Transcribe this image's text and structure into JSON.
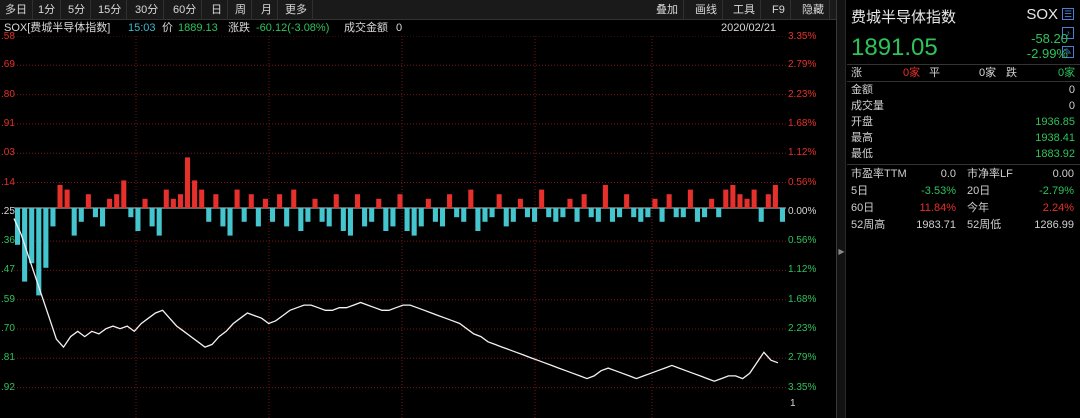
{
  "toolbar": {
    "left_items": [
      "多日",
      "1分",
      "5分",
      "15分",
      "30分",
      "60分",
      "日",
      "周",
      "月",
      "更多"
    ],
    "right_items": [
      "叠加",
      "画线",
      "工具",
      "F9",
      "隐藏"
    ]
  },
  "infobar": {
    "index_name": "SOX[费城半导体指数]",
    "time": "15:03",
    "price_label": "价",
    "price": "1889.13",
    "change_label": "涨跌",
    "change": "-60.12(-3.08%)",
    "turnover_label": "成交金额",
    "turnover": "0",
    "date": "2020/02/21"
  },
  "axis": {
    "left_labels": [
      {
        "text": ".58",
        "color": "#e6302b"
      },
      {
        "text": ".69",
        "color": "#e6302b"
      },
      {
        "text": ".80",
        "color": "#e6302b"
      },
      {
        "text": ".91",
        "color": "#e6302b"
      },
      {
        "text": ".03",
        "color": "#e6302b"
      },
      {
        "text": ".14",
        "color": "#e6302b"
      },
      {
        "text": ".25",
        "color": "#d8d8d8"
      },
      {
        "text": ".36",
        "color": "#2ec25b"
      },
      {
        "text": ".47",
        "color": "#2ec25b"
      },
      {
        "text": ".59",
        "color": "#2ec25b"
      },
      {
        "text": ".70",
        "color": "#2ec25b"
      },
      {
        "text": ".81",
        "color": "#2ec25b"
      },
      {
        "text": ".92",
        "color": "#2ec25b"
      }
    ],
    "right_labels": [
      {
        "text": "3.35%",
        "color": "#e6302b"
      },
      {
        "text": "2.79%",
        "color": "#e6302b"
      },
      {
        "text": "2.23%",
        "color": "#e6302b"
      },
      {
        "text": "1.68%",
        "color": "#e6302b"
      },
      {
        "text": "1.12%",
        "color": "#e6302b"
      },
      {
        "text": "0.56%",
        "color": "#e6302b"
      },
      {
        "text": "0.00%",
        "color": "#d8d8d8"
      },
      {
        "text": "0.56%",
        "color": "#2ec25b"
      },
      {
        "text": "1.12%",
        "color": "#2ec25b"
      },
      {
        "text": "1.68%",
        "color": "#2ec25b"
      },
      {
        "text": "2.23%",
        "color": "#2ec25b"
      },
      {
        "text": "2.79%",
        "color": "#2ec25b"
      },
      {
        "text": "3.35%",
        "color": "#2ec25b"
      }
    ],
    "bottom_right": "1"
  },
  "colors": {
    "up": "#e6302b",
    "down": "#2ec25b",
    "bar_down": "#45c6cf",
    "price_line": "#f2f2f2",
    "grid": "#7a1414",
    "zero_line": "#c8c8c8"
  },
  "chart_data": {
    "type": "line",
    "description_series": [
      {
        "name": "",
        "kind": "intraday_price_pct",
        "values": [
          -0.2,
          -0.5,
          -0.9,
          -1.3,
          -1.7,
          -2.1,
          -2.5,
          -2.65,
          -2.45,
          -2.35,
          -2.45,
          -2.35,
          -2.4,
          -2.3,
          -2.25,
          -2.3,
          -2.25,
          -2.35,
          -2.2,
          -2.1,
          -2.0,
          -1.95,
          -2.1,
          -2.25,
          -2.35,
          -2.45,
          -2.55,
          -2.65,
          -2.6,
          -2.45,
          -2.35,
          -2.2,
          -2.1,
          -2.0,
          -2.05,
          -2.1,
          -2.2,
          -2.15,
          -2.05,
          -1.95,
          -1.9,
          -1.85,
          -1.85,
          -1.9,
          -1.95,
          -1.95,
          -1.9,
          -1.9,
          -1.85,
          -1.8,
          -1.85,
          -1.9,
          -1.95,
          -1.95,
          -1.9,
          -1.85,
          -1.85,
          -1.9,
          -1.95,
          -2.0,
          -2.05,
          -2.1,
          -2.15,
          -2.2,
          -2.3,
          -2.4,
          -2.45,
          -2.55,
          -2.6,
          -2.65,
          -2.7,
          -2.75,
          -2.8,
          -2.85,
          -2.9,
          -2.95,
          -3.0,
          -3.05,
          -3.1,
          -3.15,
          -3.2,
          -3.25,
          -3.2,
          -3.1,
          -3.05,
          -3.1,
          -3.15,
          -3.2,
          -3.25,
          -3.2,
          -3.15,
          -3.1,
          -3.05,
          -3.0,
          -3.05,
          -3.1,
          -3.15,
          -3.2,
          -3.25,
          -3.3,
          -3.25,
          -3.2,
          -3.2,
          -3.25,
          -3.15,
          -2.95,
          -2.75,
          -2.9,
          -2.95
        ]
      },
      {
        "name": "",
        "kind": "momentum_bars",
        "values": [
          -0.8,
          -1.6,
          -1.2,
          -1.9,
          -1.3,
          -0.4,
          0.5,
          0.4,
          -0.6,
          -0.3,
          0.3,
          -0.2,
          -0.4,
          0.2,
          0.3,
          0.6,
          -0.2,
          -0.5,
          0.2,
          -0.4,
          -0.6,
          0.4,
          0.2,
          0.3,
          1.1,
          0.6,
          0.4,
          -0.3,
          0.3,
          -0.4,
          -0.6,
          0.4,
          -0.3,
          0.3,
          -0.4,
          0.2,
          -0.3,
          0.3,
          -0.4,
          0.4,
          -0.5,
          -0.3,
          0.2,
          -0.3,
          -0.4,
          0.3,
          -0.5,
          -0.6,
          0.3,
          -0.4,
          -0.3,
          0.2,
          -0.5,
          -0.4,
          0.3,
          -0.5,
          -0.6,
          -0.4,
          0.2,
          -0.3,
          -0.4,
          0.3,
          -0.2,
          -0.3,
          0.4,
          -0.5,
          -0.3,
          -0.2,
          0.3,
          -0.4,
          -0.3,
          0.2,
          -0.2,
          -0.3,
          0.4,
          -0.2,
          -0.3,
          -0.2,
          0.2,
          -0.3,
          0.3,
          -0.2,
          -0.3,
          0.5,
          -0.3,
          -0.2,
          0.3,
          -0.2,
          -0.3,
          -0.2,
          0.2,
          -0.3,
          0.3,
          -0.2,
          -0.2,
          0.4,
          -0.3,
          -0.2,
          0.2,
          -0.2,
          0.4,
          0.5,
          0.3,
          0.2,
          0.4,
          -0.3,
          0.3,
          0.5,
          -0.3
        ]
      }
    ],
    "ylim_pct": [
      -3.35,
      3.35
    ],
    "x_date": "2020/02/21",
    "grid": true
  },
  "panel": {
    "title": "费城半导体指数",
    "code": "SOX",
    "price": "1891.05",
    "change": "-58.20",
    "change_pct": "-2.99%",
    "breadth": {
      "up_label": "涨",
      "up_value": "0家",
      "flat_label": "平",
      "flat_value": "0家",
      "down_label": "跌",
      "down_value": "0家"
    },
    "rows": [
      {
        "label": "金额",
        "value": "0",
        "color": "#cfcfcf"
      },
      {
        "label": "成交量",
        "value": "0",
        "color": "#cfcfcf"
      },
      {
        "label": "开盘",
        "value": "1936.85",
        "color": "#2ec25b"
      },
      {
        "label": "最高",
        "value": "1938.41",
        "color": "#2ec25b"
      },
      {
        "label": "最低",
        "value": "1883.92",
        "color": "#2ec25b"
      }
    ],
    "stats": [
      {
        "l1": "市盈率TTM",
        "v1": "0.0",
        "c1": "#cfcfcf",
        "l2": "市净率LF",
        "v2": "0.00",
        "c2": "#cfcfcf"
      },
      {
        "l1": "5日",
        "v1": "-3.53%",
        "c1": "#2ec25b",
        "l2": "20日",
        "v2": "-2.79%",
        "c2": "#2ec25b"
      },
      {
        "l1": "60日",
        "v1": "11.84%",
        "c1": "#e6302b",
        "l2": "今年",
        "v2": "2.24%",
        "c2": "#e6302b"
      },
      {
        "l1": "52周高",
        "v1": "1983.71",
        "c1": "#cfcfcf",
        "l2": "52周低",
        "v2": "1286.99",
        "c2": "#cfcfcf"
      }
    ]
  }
}
